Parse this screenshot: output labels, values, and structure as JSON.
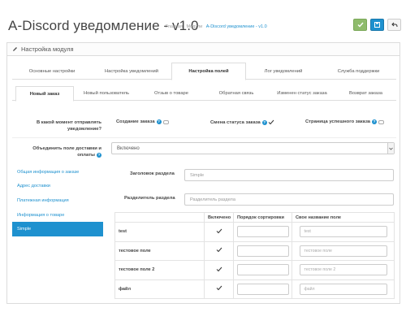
{
  "header": {
    "title": "A-Discord уведомление - v1.0",
    "breadcrumb": [
      "Главная",
      "Модули",
      "A-Discord уведомление - v1.0"
    ]
  },
  "panel": {
    "heading": "Настройка модуля"
  },
  "main_tabs": [
    {
      "label": "Основные настройки"
    },
    {
      "label": "Настройка уведомлений"
    },
    {
      "label": "Настройка полей"
    },
    {
      "label": "Лог уведомлений"
    },
    {
      "label": "Служба поддержки"
    }
  ],
  "active_main_tab": "Настройка полей",
  "sub_tabs": [
    {
      "label": "Новый заказ"
    },
    {
      "label": "Новый пользователь"
    },
    {
      "label": "Отзыв о товаре"
    },
    {
      "label": "Обратная связь"
    },
    {
      "label": "Изменен статус заказа"
    },
    {
      "label": "Возврат заказа"
    }
  ],
  "active_sub_tab": "Новый заказ",
  "send_moment": {
    "label": "В какой момент отправлять уведомление?",
    "options": [
      {
        "label": "Создание заказа",
        "checked": false
      },
      {
        "label": "Смена статуса заказа",
        "checked": true
      },
      {
        "label": "Страница успешного заказа",
        "checked": false
      }
    ]
  },
  "merge_fields": {
    "label": "Объединить поле доставки и оплаты",
    "value": "Включено"
  },
  "left_nav": [
    {
      "label": "Общая информация о заказе"
    },
    {
      "label": "Адрес доставки"
    },
    {
      "label": "Платежная информация"
    },
    {
      "label": "Информация о товаре"
    },
    {
      "label": "Simple"
    }
  ],
  "active_nav": "Simple",
  "section_title": {
    "label": "Заголовок раздела",
    "placeholder": "Simple"
  },
  "section_separator": {
    "label": "Разделитель раздела",
    "placeholder": "Разделитель раздела"
  },
  "table": {
    "columns": [
      "",
      "Включено",
      "Порядок сортировки",
      "Свое название поле"
    ],
    "rows": [
      {
        "field": "test",
        "enabled": true,
        "sort": "",
        "custom_placeholder": "test"
      },
      {
        "field": "тестовое поле",
        "enabled": true,
        "sort": "",
        "custom_placeholder": "тестовое поле"
      },
      {
        "field": "тестовое поле 2",
        "enabled": true,
        "sort": "",
        "custom_placeholder": "тестовое поле 2"
      },
      {
        "field": "файл",
        "enabled": true,
        "sort": "",
        "custom_placeholder": "файл"
      }
    ]
  },
  "colors": {
    "accent": "#1e91cf",
    "success": "#8fbb6c"
  },
  "icons": {
    "save": "check-icon",
    "save_stay": "floppy-icon",
    "back": "reply-icon",
    "panel": "pencil-icon"
  }
}
